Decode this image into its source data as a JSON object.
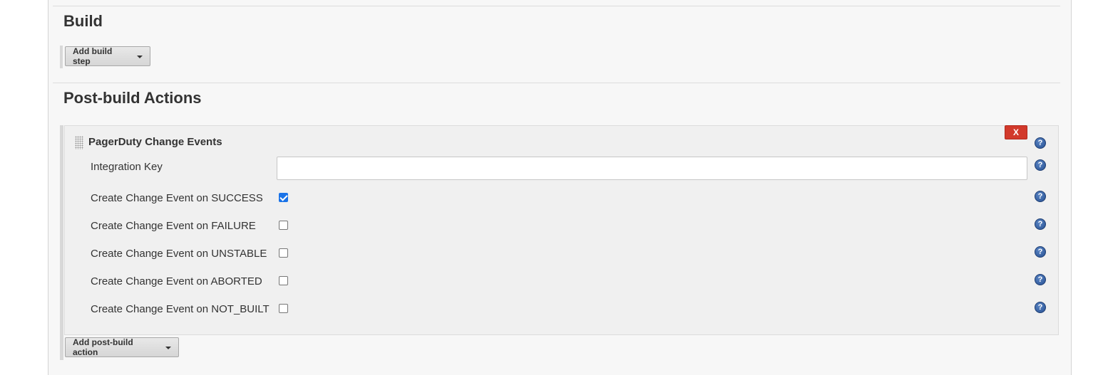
{
  "build": {
    "title": "Build",
    "add_step_label": "Add build step"
  },
  "post_build": {
    "title": "Post-build Actions",
    "add_action_label": "Add post-build action",
    "publisher": {
      "title": "PagerDuty Change Events",
      "delete_label": "X",
      "integration_key": {
        "label": "Integration Key",
        "value": ""
      },
      "options": [
        {
          "label": "Create Change Event on SUCCESS",
          "checked": true
        },
        {
          "label": "Create Change Event on FAILURE",
          "checked": false
        },
        {
          "label": "Create Change Event on UNSTABLE",
          "checked": false
        },
        {
          "label": "Create Change Event on ABORTED",
          "checked": false
        },
        {
          "label": "Create Change Event on NOT_BUILT",
          "checked": false
        }
      ]
    }
  },
  "help_glyph": "?",
  "colors": {
    "delete_red": "#d2392b",
    "help_blue": "#2f5d9f",
    "checkbox_blue": "#1a73e8"
  }
}
